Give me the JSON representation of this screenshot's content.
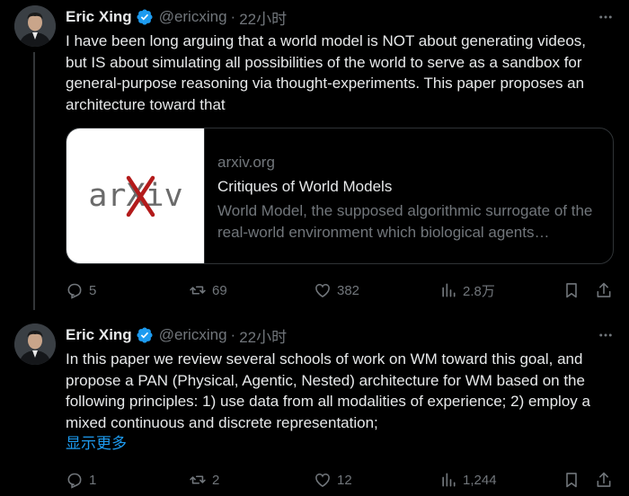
{
  "colors": {
    "accent": "#1d9bf0",
    "muted": "#71767b",
    "text": "#e7e9ea",
    "background": "#000000"
  },
  "tweets": [
    {
      "author": "Eric Xing",
      "handle": "@ericxing",
      "separator": "·",
      "time": "22小时",
      "verified_icon": "verified-badge-icon",
      "text": "I have been long arguing that a world model is NOT about generating videos, but IS about simulating all possibilities of the world to serve as a sandbox for general-purpose reasoning via thought-experiments. This paper proposes an architecture toward that",
      "card": {
        "logo_text": "arXiv",
        "domain": "arxiv.org",
        "title": "Critiques of World Models",
        "description": "World Model, the supposed algorithmic surrogate of the real-world environment which biological agents experience with and act upon, has been an emerging topic in recent years"
      },
      "actions": {
        "replies": "5",
        "retweets": "69",
        "likes": "382",
        "views": "2.8万"
      }
    },
    {
      "author": "Eric Xing",
      "handle": "@ericxing",
      "separator": "·",
      "time": "22小时",
      "verified_icon": "verified-badge-icon",
      "text": "In this paper we review several schools of work on WM toward this goal, and propose a PAN (Physical, Agentic, Nested) architecture for WM based on the following principles: 1) use data from all modalities of  experience; 2) employ a mixed continuous and discrete representation;",
      "show_more": "显示更多",
      "actions": {
        "replies": "1",
        "retweets": "2",
        "likes": "12",
        "views": "1,244"
      }
    }
  ]
}
